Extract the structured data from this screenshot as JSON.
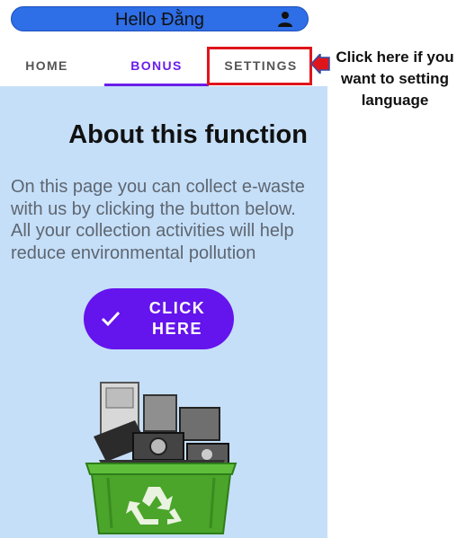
{
  "header": {
    "title": "Hello Đằng",
    "user_icon": "user-icon"
  },
  "tabs": [
    {
      "label": "HOME",
      "selected": false
    },
    {
      "label": "BONUS",
      "selected": true
    },
    {
      "label": "SETTINGS",
      "selected": false
    }
  ],
  "content": {
    "heading": "About this function",
    "paragraph": "On this page you can collect e-waste with us by clicking the button below. All your collection activities will help reduce environmental pollution",
    "cta_label": "CLICK\nHERE",
    "cta_icon": "check-icon",
    "illustration": "e-waste-recycle-bin"
  },
  "annotation": {
    "text": "Click here if you want to setting language"
  },
  "colors": {
    "header_bg": "#2e6ee6",
    "accent": "#6a1ee8",
    "content_bg": "#c5dff9",
    "highlight": "#e0151b"
  }
}
